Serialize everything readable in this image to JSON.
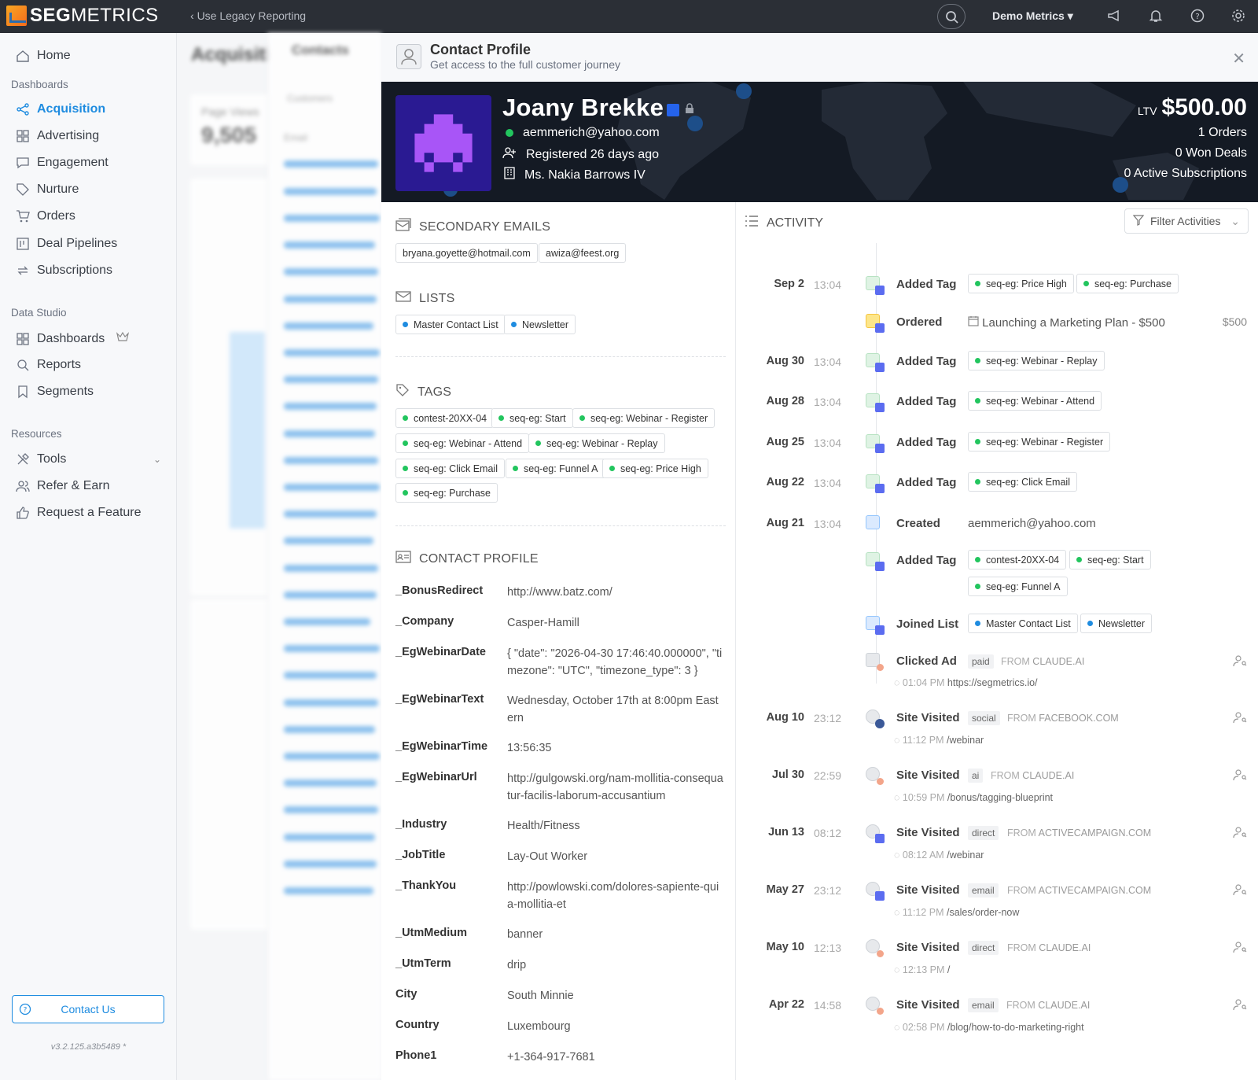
{
  "topbar": {
    "logo_prefix": "SEG",
    "logo_suffix": "METRICS",
    "legacy_link": "Use Legacy Reporting",
    "account": "Demo Metrics",
    "icons": [
      "search-icon",
      "megaphone-icon",
      "bell-icon",
      "help-icon",
      "gear-icon"
    ]
  },
  "sidebar": {
    "home": "Home",
    "dashboards_section": "Dashboards",
    "items": [
      "Acquisition",
      "Advertising",
      "Engagement",
      "Nurture",
      "Orders",
      "Deal Pipelines",
      "Subscriptions"
    ],
    "data_studio_section": "Data Studio",
    "studio_items": [
      "Dashboards",
      "Reports",
      "Segments"
    ],
    "resources_section": "Resources",
    "resource_items": [
      "Tools",
      "Refer & Earn",
      "Request a Feature"
    ],
    "contact_button": "Contact Us",
    "version": "v3.2.125.a3b5489 *"
  },
  "background": {
    "page_title": "Acquisiti",
    "page_views_label": "Page Views",
    "page_views_value": "9,505",
    "contacts_title": "Contacts",
    "customers_tab": "Customers",
    "email_col": "Email"
  },
  "profile": {
    "title": "Contact Profile",
    "subtitle": "Get access to the full customer journey",
    "name": "Joany Brekke",
    "email": "aemmerich@yahoo.com",
    "registered": "Registered 26 days ago",
    "company_contact": "Ms. Nakia Barrows IV",
    "ltv_label": "LTV",
    "ltv_value": "$500.00",
    "orders": "1 Orders",
    "won_deals": "0 Won Deals",
    "subscriptions": "0 Active Subscriptions"
  },
  "secondary_emails": {
    "title": "SECONDARY EMAILS",
    "items": [
      "bryana.goyette@hotmail.com",
      "awiza@feest.org"
    ]
  },
  "lists": {
    "title": "LISTS",
    "items": [
      "Master Contact List",
      "Newsletter"
    ]
  },
  "tags": {
    "title": "TAGS",
    "items": [
      "contest-20XX-04",
      "seq-eg: Start",
      "seq-eg: Webinar - Register",
      "seq-eg: Webinar - Attend",
      "seq-eg: Webinar - Replay",
      "seq-eg: Click Email",
      "seq-eg: Funnel A",
      "seq-eg: Price High",
      "seq-eg: Purchase"
    ]
  },
  "contact_profile": {
    "title": "CONTACT PROFILE",
    "fields": [
      {
        "k": "_BonusRedirect",
        "v": "http://www.batz.com/"
      },
      {
        "k": "_Company",
        "v": "Casper-Hamill"
      },
      {
        "k": "_EgWebinarDate",
        "v": "{ \"date\": \"2026-04-30 17:46:40.000000\", \"timezone\": \"UTC\", \"timezone_type\": 3 }"
      },
      {
        "k": "_EgWebinarText",
        "v": "Wednesday, October 17th at 8:00pm Eastern"
      },
      {
        "k": "_EgWebinarTime",
        "v": "13:56:35"
      },
      {
        "k": "_EgWebinarUrl",
        "v": "http://gulgowski.org/nam-mollitia-consequatur-facilis-laborum-accusantium"
      },
      {
        "k": "_Industry",
        "v": "Health/Fitness"
      },
      {
        "k": "_JobTitle",
        "v": "Lay-Out Worker"
      },
      {
        "k": "_ThankYou",
        "v": "http://powlowski.com/dolores-sapiente-quia-mollitia-et"
      },
      {
        "k": "_UtmMedium",
        "v": "banner"
      },
      {
        "k": "_UtmTerm",
        "v": "drip"
      },
      {
        "k": "City",
        "v": "South Minnie"
      },
      {
        "k": "Country",
        "v": "Luxembourg"
      },
      {
        "k": "Phone1",
        "v": "+1-364-917-7681"
      }
    ]
  },
  "activity": {
    "title": "ACTIVITY",
    "filter": "Filter Activities",
    "rows": [
      {
        "date": "Sep 2",
        "time": "13:04",
        "label": "Added Tag",
        "tags": [
          "seq-eg: Price High",
          "seq-eg: Purchase"
        ]
      },
      {
        "label": "Ordered",
        "product": "Launching a Marketing Plan - $500",
        "amount": "$500"
      },
      {
        "date": "Aug 30",
        "time": "13:04",
        "label": "Added Tag",
        "tags": [
          "seq-eg: Webinar - Replay"
        ]
      },
      {
        "date": "Aug 28",
        "time": "13:04",
        "label": "Added Tag",
        "tags": [
          "seq-eg: Webinar - Attend"
        ]
      },
      {
        "date": "Aug 25",
        "time": "13:04",
        "label": "Added Tag",
        "tags": [
          "seq-eg: Webinar - Register"
        ]
      },
      {
        "date": "Aug 22",
        "time": "13:04",
        "label": "Added Tag",
        "tags": [
          "seq-eg: Click Email"
        ]
      },
      {
        "date": "Aug 21",
        "time": "13:04",
        "label": "Created",
        "text": "aemmerich@yahoo.com"
      },
      {
        "label": "Added Tag",
        "tags": [
          "contest-20XX-04",
          "seq-eg: Start",
          "seq-eg: Funnel A"
        ]
      },
      {
        "label": "Joined List",
        "tags": [
          "Master Contact List",
          "Newsletter"
        ]
      },
      {
        "label": "Clicked Ad",
        "channel": "paid",
        "from": "CLAUDE.AI",
        "sub_time": "01:04 PM",
        "sub_path": "https://segmetrics.io/"
      },
      {
        "date": "Aug 10",
        "time": "23:12",
        "label": "Site Visited",
        "channel": "social",
        "from": "FACEBOOK.COM",
        "sub_time": "11:12 PM",
        "sub_path": "/webinar"
      },
      {
        "date": "Jul 30",
        "time": "22:59",
        "label": "Site Visited",
        "channel": "ai",
        "from": "CLAUDE.AI",
        "sub_time": "10:59 PM",
        "sub_path": "/bonus/tagging-blueprint"
      },
      {
        "date": "Jun 13",
        "time": "08:12",
        "label": "Site Visited",
        "channel": "direct",
        "from": "ACTIVECAMPAIGN.COM",
        "sub_time": "08:12 AM",
        "sub_path": "/webinar"
      },
      {
        "date": "May 27",
        "time": "23:12",
        "label": "Site Visited",
        "channel": "email",
        "from": "ACTIVECAMPAIGN.COM",
        "sub_time": "11:12 PM",
        "sub_path": "/sales/order-now"
      },
      {
        "date": "May 10",
        "time": "12:13",
        "label": "Site Visited",
        "channel": "direct",
        "from": "CLAUDE.AI",
        "sub_time": "12:13 PM",
        "sub_path": "/"
      },
      {
        "date": "Apr 22",
        "time": "14:58",
        "label": "Site Visited",
        "channel": "email",
        "from": "CLAUDE.AI",
        "sub_time": "02:58 PM",
        "sub_path": "/blog/how-to-do-marketing-right"
      }
    ],
    "from_word": "FROM"
  },
  "colors": {
    "accent": "#1f8ce0",
    "topbar": "#2b2f36",
    "hero": "#141a24",
    "avatar": "#2a1a92",
    "tag_dot": "#22c55e",
    "list_dot": "#1f8ce0"
  }
}
